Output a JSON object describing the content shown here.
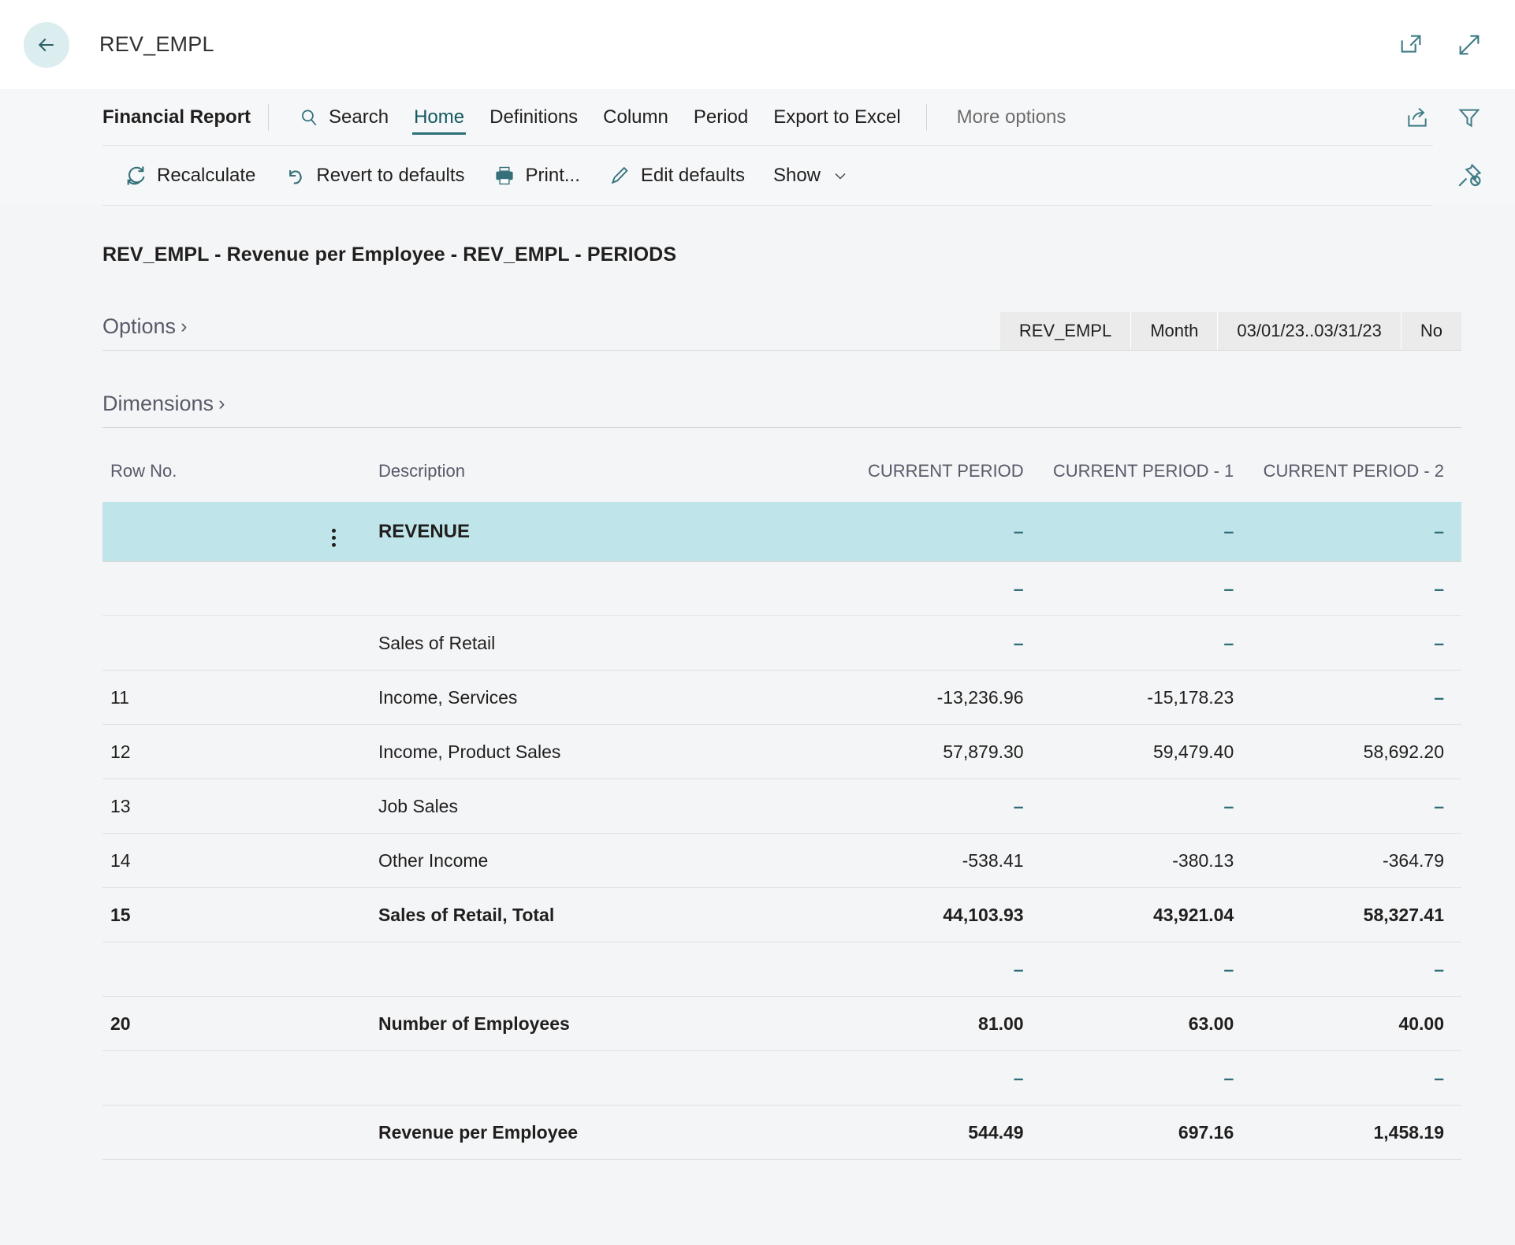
{
  "titlebar": {
    "back_label": "back-arrow",
    "app_title": "REV_EMPL",
    "open_new_window_label": "Open in new window",
    "expand_label": "Expand"
  },
  "commandbar": {
    "section_label": "Financial Report",
    "nav": [
      {
        "label": "Search",
        "icon": "search-icon",
        "state": "normal"
      },
      {
        "label": "Home",
        "state": "active"
      },
      {
        "label": "Definitions",
        "state": "normal"
      },
      {
        "label": "Column",
        "state": "normal"
      },
      {
        "label": "Period",
        "state": "normal"
      },
      {
        "label": "Export to Excel",
        "state": "normal"
      },
      {
        "label": "More options",
        "state": "muted"
      }
    ],
    "share_label": "Share",
    "filter_label": "Filter",
    "actions": [
      {
        "label": "Recalculate",
        "icon": "refresh-icon"
      },
      {
        "label": "Revert to defaults",
        "icon": "undo-icon"
      },
      {
        "label": "Print...",
        "icon": "printer-icon"
      },
      {
        "label": "Edit defaults",
        "icon": "pencil-icon"
      },
      {
        "label": "Show",
        "icon": "chevron-down-icon"
      }
    ],
    "unpin_label": "Unpin"
  },
  "report": {
    "title": "REV_EMPL - Revenue per Employee - REV_EMPL - PERIODS",
    "options_label": "Options",
    "dimensions_label": "Dimensions",
    "chips": [
      "REV_EMPL",
      "Month",
      "03/01/23..03/31/23",
      "No"
    ]
  },
  "table": {
    "headers": {
      "row_no": "Row No.",
      "description": "Description",
      "c0": "CURRENT PERIOD",
      "c1": "CURRENT PERIOD - 1",
      "c2": "CURRENT PERIOD - 2"
    },
    "rows": [
      {
        "row_no": "",
        "description": "REVENUE",
        "c0": "–",
        "c1": "–",
        "c2": "–",
        "bold": true,
        "highlight": true,
        "dots": true
      },
      {
        "row_no": "",
        "description": "",
        "c0": "–",
        "c1": "–",
        "c2": "–",
        "bold": false,
        "highlight": false,
        "dots": false
      },
      {
        "row_no": "",
        "description": "Sales of Retail",
        "c0": "–",
        "c1": "–",
        "c2": "–",
        "bold": false,
        "highlight": false,
        "dots": false
      },
      {
        "row_no": "11",
        "description": "Income, Services",
        "c0": "-13,236.96",
        "c1": "-15,178.23",
        "c2": "–",
        "bold": false,
        "highlight": false,
        "dots": false
      },
      {
        "row_no": "12",
        "description": "Income, Product Sales",
        "c0": "57,879.30",
        "c1": "59,479.40",
        "c2": "58,692.20",
        "bold": false,
        "highlight": false,
        "dots": false
      },
      {
        "row_no": "13",
        "description": "Job Sales",
        "c0": "–",
        "c1": "–",
        "c2": "–",
        "bold": false,
        "highlight": false,
        "dots": false
      },
      {
        "row_no": "14",
        "description": "Other Income",
        "c0": "-538.41",
        "c1": "-380.13",
        "c2": "-364.79",
        "bold": false,
        "highlight": false,
        "dots": false
      },
      {
        "row_no": "15",
        "description": "Sales of Retail, Total",
        "c0": "44,103.93",
        "c1": "43,921.04",
        "c2": "58,327.41",
        "bold": true,
        "highlight": false,
        "dots": false
      },
      {
        "row_no": "",
        "description": "",
        "c0": "–",
        "c1": "–",
        "c2": "–",
        "bold": false,
        "highlight": false,
        "dots": false
      },
      {
        "row_no": "20",
        "description": "Number of Employees",
        "c0": "81.00",
        "c1": "63.00",
        "c2": "40.00",
        "bold": true,
        "highlight": false,
        "dots": false
      },
      {
        "row_no": "",
        "description": "",
        "c0": "–",
        "c1": "–",
        "c2": "–",
        "bold": false,
        "highlight": false,
        "dots": false
      },
      {
        "row_no": "",
        "description": "Revenue per Employee",
        "c0": "544.49",
        "c1": "697.16",
        "c2": "1,458.19",
        "bold": true,
        "highlight": false,
        "dots": false
      }
    ]
  },
  "colors": {
    "accent": "#2c6f78",
    "highlight_row": "#bfe5ea",
    "back_circle": "#dcedef",
    "page_bg": "#f4f5f7"
  }
}
